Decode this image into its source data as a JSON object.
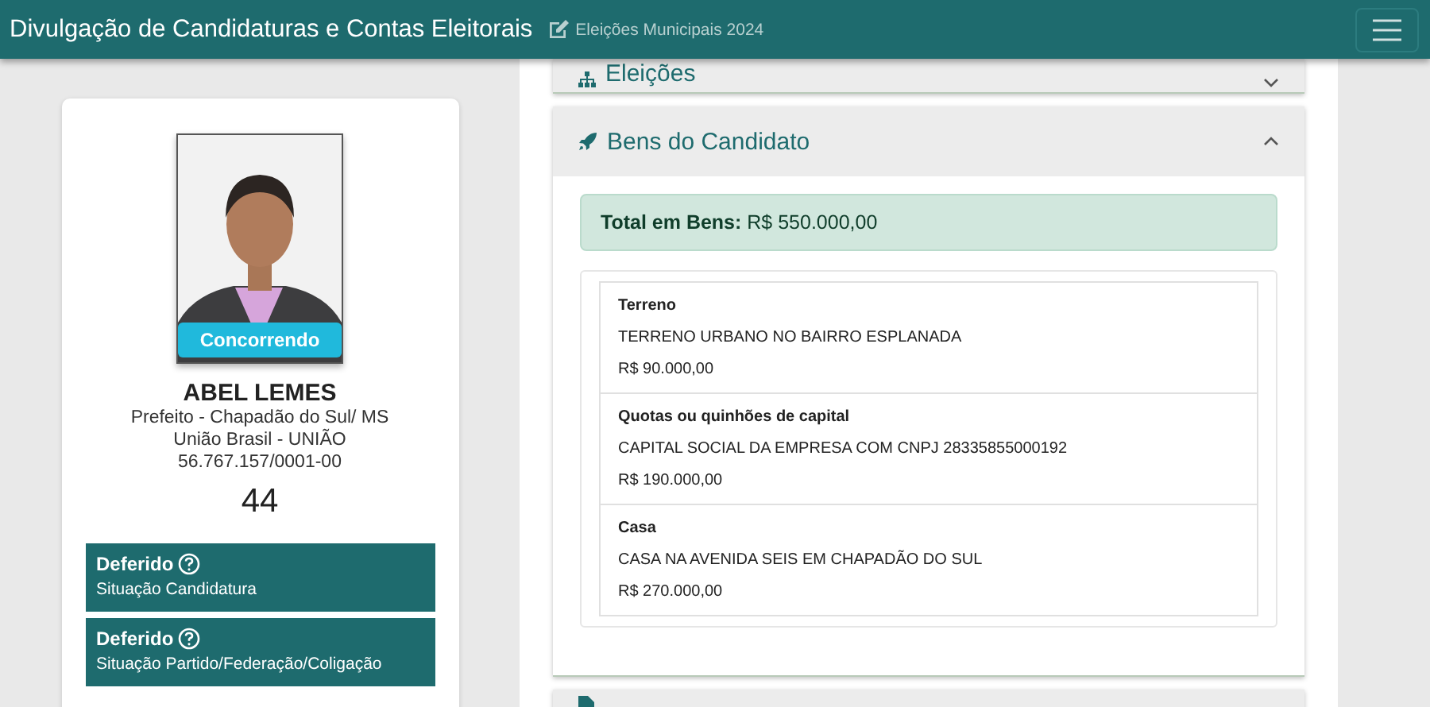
{
  "navbar": {
    "title": "Divulgação de Candidaturas e Contas Eleitorais",
    "subtitle": "Eleições Municipais 2024"
  },
  "candidate": {
    "badge": "Concorrendo",
    "name": "ABEL LEMES",
    "details": [
      "Prefeito - Chapadão do Sul/ MS",
      "União Brasil - UNIÃO",
      "56.767.157/0001-00"
    ],
    "number": "44",
    "statuses": [
      {
        "value": "Deferido",
        "label": "Situação Candidatura"
      },
      {
        "value": "Deferido",
        "label": "Situação Partido/Federação/Coligação"
      }
    ]
  },
  "panels": [
    {
      "kind": "elections",
      "title": "Eleições",
      "expanded": false
    },
    {
      "kind": "assets",
      "title": "Bens do Candidato",
      "expanded": true,
      "total_label": "Total em Bens:",
      "total_value": "R$ 550.000,00",
      "assets": [
        {
          "type": "Terreno",
          "description": "TERRENO URBANO NO BAIRRO ESPLANADA",
          "value": "R$ 90.000,00"
        },
        {
          "type": "Quotas ou quinhões de capital",
          "description": "CAPITAL SOCIAL DA EMPRESA COM CNPJ 28335855000192",
          "value": "R$ 190.000,00"
        },
        {
          "type": "Casa",
          "description": "CASA NA AVENIDA SEIS EM CHAPADÃO DO SUL",
          "value": "R$ 270.000,00"
        }
      ]
    },
    {
      "kind": "documents"
    }
  ]
}
